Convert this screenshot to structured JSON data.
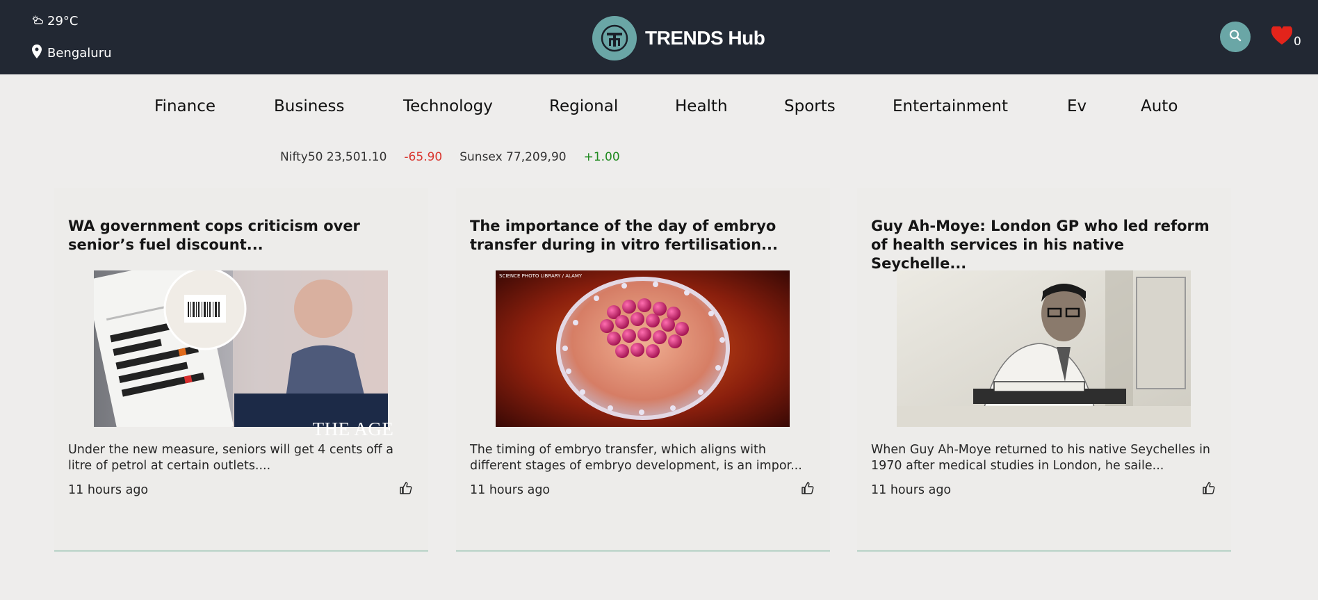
{
  "header": {
    "temperature": "29°C",
    "location": "Bengaluru",
    "brand": "TRENDS Hub",
    "favorites_count": "0",
    "accent_color": "#6aa6a6"
  },
  "nav": {
    "items": [
      "Finance",
      "Business",
      "Technology",
      "Regional",
      "Health",
      "Sports",
      "Entertainment",
      "Ev",
      "Auto"
    ]
  },
  "market": {
    "nifty": "Nifty50 23,501.10",
    "nifty_change": "-65.90",
    "sensex": "Sunsex 77,209,90",
    "sensex_change": "+1.00"
  },
  "articles": [
    {
      "title": "WA government cops criticism over senior’s fuel discount...",
      "image_watermark": "THE AGE",
      "description": "Under the new measure, seniors will get 4 cents off a litre of petrol at certain outlets....",
      "time": "11 hours ago"
    },
    {
      "title": "The importance of the day of embryo transfer during in vitro fertilisation...",
      "image_watermark": "SCIENCE PHOTO LIBRARY / ALAMY",
      "description": "The timing of embryo transfer, which aligns with different stages of embryo development, is an impor...",
      "time": "11 hours ago"
    },
    {
      "title": "Guy Ah-Moye: London GP who led reform of health services in his native Seychelle...",
      "description": "When Guy Ah-Moye returned to his native Seychelles in 1970 after medical studies in London, he saile...",
      "time": "11 hours ago"
    }
  ]
}
